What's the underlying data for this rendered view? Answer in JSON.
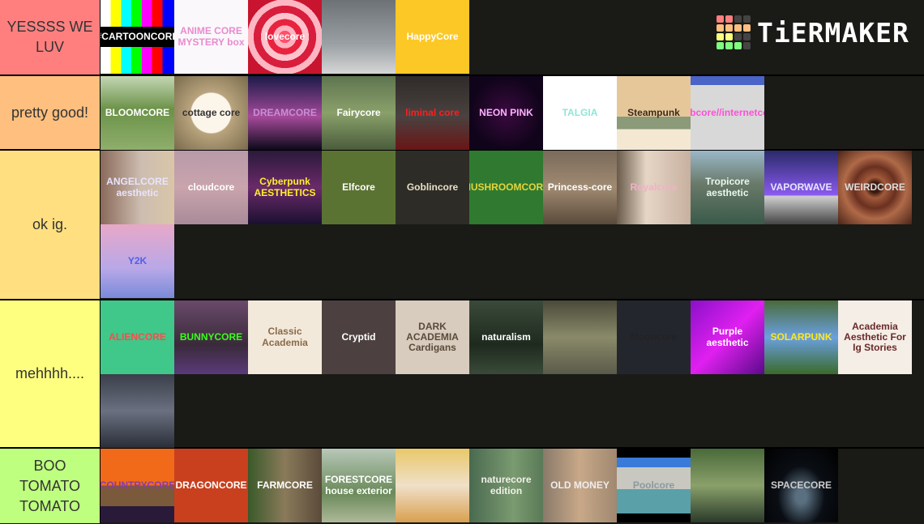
{
  "app": {
    "name": "TierMaker",
    "logo_text": "TiERMAKER"
  },
  "logo_grid_colors": [
    "#ff7f7f",
    "#ff7f7f",
    "#444444",
    "#444444",
    "#ffbf7f",
    "#ffbf7f",
    "#ffbf7f",
    "#ffbf7f",
    "#ffff7f",
    "#ffff7f",
    "#444444",
    "#444444",
    "#7fff7f",
    "#7fff7f",
    "#7fff7f",
    "#444444"
  ],
  "tiers": [
    {
      "label": "YESSSS WE LUV",
      "color": "#ff7f7f",
      "rows": 1,
      "items": [
        {
          "title": "#CARTOONCORE",
          "bg": "linear-gradient(90deg,#fff 0 14%,#ff0 14% 28%,#0ff 28% 42%,#0f0 42% 56%,#f0f 56% 70%,#f00 70% 84%,#00f 84%)",
          "fg": "#fff",
          "labelbg": "#000"
        },
        {
          "title": "ANIME CORE MYSTERY box",
          "bg": "#fbf8fb",
          "fg": "#e88bd0"
        },
        {
          "title": "lovecore",
          "bg": "radial-gradient(circle,#ff4f6a 0 12%,#ffb3c1 12% 22%,#e8233f 22% 34%,#ffc3cd 34% 46%,#d81e3c 46% 60%,#ffb6c3 60% 72%,#c8142f 72%)",
          "fg": "#fff"
        },
        {
          "title": "",
          "bg": "linear-gradient(180deg,#6d7277,#9aa0a4 60%,#d6d6d6)",
          "fg": "#fff"
        },
        {
          "title": "HappyCore",
          "bg": "#fcc826",
          "fg": "#fff"
        }
      ]
    },
    {
      "label": "pretty good!",
      "color": "#ffbf7f",
      "rows": 1,
      "items": [
        {
          "title": "BLOOMCORE",
          "bg": "linear-gradient(180deg,#c4d6b4,#6b9248 45%,#8fae6c)",
          "fg": "#fff"
        },
        {
          "title": "cottage core",
          "bg": "radial-gradient(circle,#fbf5ea 0 38%,#b9a47d 40%,#7a6b4d)",
          "fg": "#333"
        },
        {
          "title": "DREAMCORE",
          "bg": "linear-gradient(180deg,#1c1b48,#a54a9a 55%,#0c0a1a)",
          "fg": "#c98ed6"
        },
        {
          "title": "Fairycore",
          "bg": "linear-gradient(180deg,#5f7550,#8aa06a 50%,#4a5c3c)",
          "fg": "#fff"
        },
        {
          "title": "liminal core",
          "bg": "linear-gradient(180deg,#2f2b28,#4a4240 55%,#6a1515)",
          "fg": "#ff1e1e"
        },
        {
          "title": "NEON PINK",
          "bg": "radial-gradient(circle,#3a0a3f,#10041a 70%)",
          "fg": "#ffb1ff"
        },
        {
          "title": "TALGIA",
          "bg": "#ffffff",
          "fg": "#8ee6d8"
        },
        {
          "title": "Steampunk",
          "bg": "linear-gradient(180deg,#e6c79a 0 55%,#8b9a78 55% 72%,#f4e8d3 72%)",
          "fg": "#3a2b1a"
        },
        {
          "title": "webcore//internetcore",
          "bg": "linear-gradient(180deg,#4a64c8 0 12%,#d8d8d8 12%)",
          "fg": "#ff4fd8"
        }
      ]
    },
    {
      "label": "ok ig.",
      "color": "#ffdf7f",
      "rows": 2,
      "items": [
        {
          "title": "ANGELCORE aesthetic",
          "bg": "linear-gradient(90deg,#8a6a5a,#cdbdb0 55%,#d9c6a8)",
          "fg": "#e8e3ff"
        },
        {
          "title": "cloudcore",
          "bg": "linear-gradient(180deg,#b89aa8,#c9a4ad 50%,#a98a98)",
          "fg": "#fff"
        },
        {
          "title": "Cyberpunk AESTHETICS",
          "bg": "linear-gradient(180deg,#2a1a3a,#6a2a6a 50%,#1a1030)",
          "fg": "#ffef2a"
        },
        {
          "title": "Elfcore",
          "bg": "#5b7332",
          "fg": "#fff"
        },
        {
          "title": "Goblincore",
          "bg": "#2e2c26",
          "fg": "#e8e0c8"
        },
        {
          "title": "MUSHROOMCORE",
          "bg": "#2f7a30",
          "fg": "#e6d43a"
        },
        {
          "title": "Princess-core",
          "bg": "linear-gradient(180deg,#7a6a5a,#a08a72 50%,#5a4a3a)",
          "fg": "#fff"
        },
        {
          "title": "Royalcore",
          "bg": "linear-gradient(90deg,#6a5a4a,#e6d6c6 40%,#c8b0a0)",
          "fg": "#f3b0c8"
        },
        {
          "title": "Tropicore aesthetic",
          "bg": "linear-gradient(180deg,#9ab8c8,#6a7a6a 45%,#3a5a4a)",
          "fg": "#e8f8ee"
        },
        {
          "title": "VAPORWAVE",
          "bg": "linear-gradient(180deg,#2a2a6a,#8a5af0 60%,#cfcfcf 62%,#444)",
          "fg": "#e6e6ff"
        },
        {
          "title": "WEIRDCORE",
          "bg": "radial-gradient(circle,#3a1a10 0 10%,#a25a3a 20%,#6a3020 40%,#b06a48 60%,#4a2418)",
          "fg": "#ddd"
        },
        {
          "title": "Y2K",
          "bg": "linear-gradient(180deg,#e8a8c8,#b8a8e8 60%,#7a8ad8)",
          "fg": "#5060e8"
        }
      ]
    },
    {
      "label": "mehhhh....",
      "color": "#ffff7f",
      "rows": 2,
      "items": [
        {
          "title": "ALIENCORE",
          "bg": "#3fc88a",
          "fg": "#ff4a4a"
        },
        {
          "title": "BUNNYCORE",
          "bg": "linear-gradient(180deg,#6a4a6a,#3a2a3a 60%,#5a3a7a)",
          "fg": "#3aff1a"
        },
        {
          "title": "Classic Academia",
          "bg": "#f3e9da",
          "fg": "#8a6a4a"
        },
        {
          "title": "Cryptid",
          "bg": "#4d4040",
          "fg": "#fff"
        },
        {
          "title": "DARK ACADEMIA Cardigans",
          "bg": "#d8ccbe",
          "fg": "#5a4a3a"
        },
        {
          "title": "naturalism",
          "bg": "linear-gradient(180deg,#3a4a3a,#1e2a1e 60%,#3a4a3a)",
          "fg": "#fff"
        },
        {
          "title": "",
          "bg": "linear-gradient(180deg,#4a4a3a,#8a8a6a 50%,#5a5a4a)",
          "fg": "#fff"
        },
        {
          "title": "Mooncore",
          "bg": "#24262d",
          "fg": "#222"
        },
        {
          "title": "Purple aesthetic",
          "bg": "linear-gradient(135deg,#8a10c8,#e020f0 50%,#5a0a8a)",
          "fg": "#fff"
        },
        {
          "title": "SOLARPUNK",
          "bg": "linear-gradient(180deg,#4a6a3a,#6aa0e0 50%,#3a6a2a)",
          "fg": "#ffe81a"
        },
        {
          "title": "Academia Aesthetic For Ig Stories",
          "bg": "#f5eee6",
          "fg": "#6a2a2a"
        },
        {
          "title": "",
          "bg": "linear-gradient(180deg,#3a3f4a,#6a7080 50%,#2a2e38)",
          "fg": "#fff"
        }
      ]
    },
    {
      "label": "BOO TOMATO TOMATO",
      "color": "#bfff7f",
      "rows": 1,
      "items": [
        {
          "title": "COUNTRYCORE",
          "bg": "linear-gradient(180deg,#f06a1a 0 50%,#7a5a3a 50% 78%,#2a1a3a 78%)",
          "fg": "#8a3aa8"
        },
        {
          "title": "DRAGONCORE",
          "bg": "#c8401e",
          "fg": "#fff"
        },
        {
          "title": "FARMCORE",
          "bg": "linear-gradient(90deg,#3a5a2a,#8a7a5a 50%,#5a4a3a)",
          "fg": "#fff"
        },
        {
          "title": "FORESTCORE house exterior",
          "bg": "linear-gradient(180deg,#b8c8b8,#6a8a5a 60%,#aeb898)",
          "fg": "#fff"
        },
        {
          "title": "",
          "bg": "linear-gradient(180deg,#e8c86a,#f0e0c8 50%,#d8a050)",
          "fg": "#fff"
        },
        {
          "title": "naturecore edition",
          "bg": "linear-gradient(90deg,#4a6a50,#7a9a70 60%,#5a7a58)",
          "fg": "#f0f0e8"
        },
        {
          "title": "OLD MONEY",
          "bg": "linear-gradient(90deg,#8a7a6a,#c8a888 50%,#a08870)",
          "fg": "#eee"
        },
        {
          "title": "Poolcore",
          "bg": "linear-gradient(180deg,#000 0 12%,#3a7ad8 12% 25%,#c8c8c0 25% 55%,#5aa0a8 55% 88%,#000 88%)",
          "fg": "#8a9aa0"
        },
        {
          "title": "",
          "bg": "linear-gradient(180deg,#4a6a3a,#8aa06a 50%,#2a3a2a)",
          "fg": "#fff"
        },
        {
          "title": "SPACECORE",
          "bg": "radial-gradient(ellipse at 50% 65%,#5a7080 0 10%,#0a0e14 45%,#000)",
          "fg": "#ccc"
        }
      ]
    }
  ]
}
